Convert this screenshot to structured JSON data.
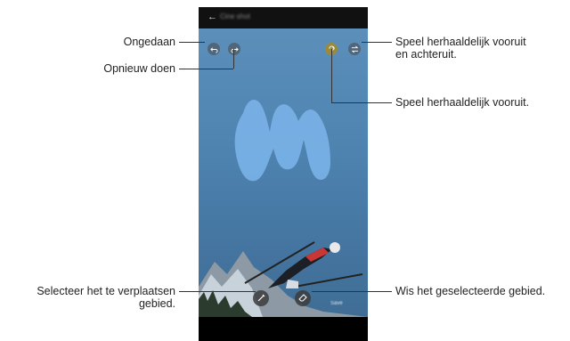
{
  "phone": {
    "header_title": "Cine shot",
    "save_label": "Save"
  },
  "callouts": {
    "undo": "Ongedaan",
    "redo": "Opnieuw doen",
    "loop_bounce_1": "Speel herhaaldelijk vooruit",
    "loop_bounce_2": "en achteruit.",
    "loop_forward": "Speel herhaaldelijk vooruit.",
    "select_move_1": "Selecteer het te verplaatsen",
    "select_move_2": "gebied.",
    "erase": "Wis het geselecteerde gebied."
  },
  "colors": {
    "selection": "#7ab3e8",
    "sky": "#4f84b1",
    "active_tool": "#9a8a3b"
  }
}
